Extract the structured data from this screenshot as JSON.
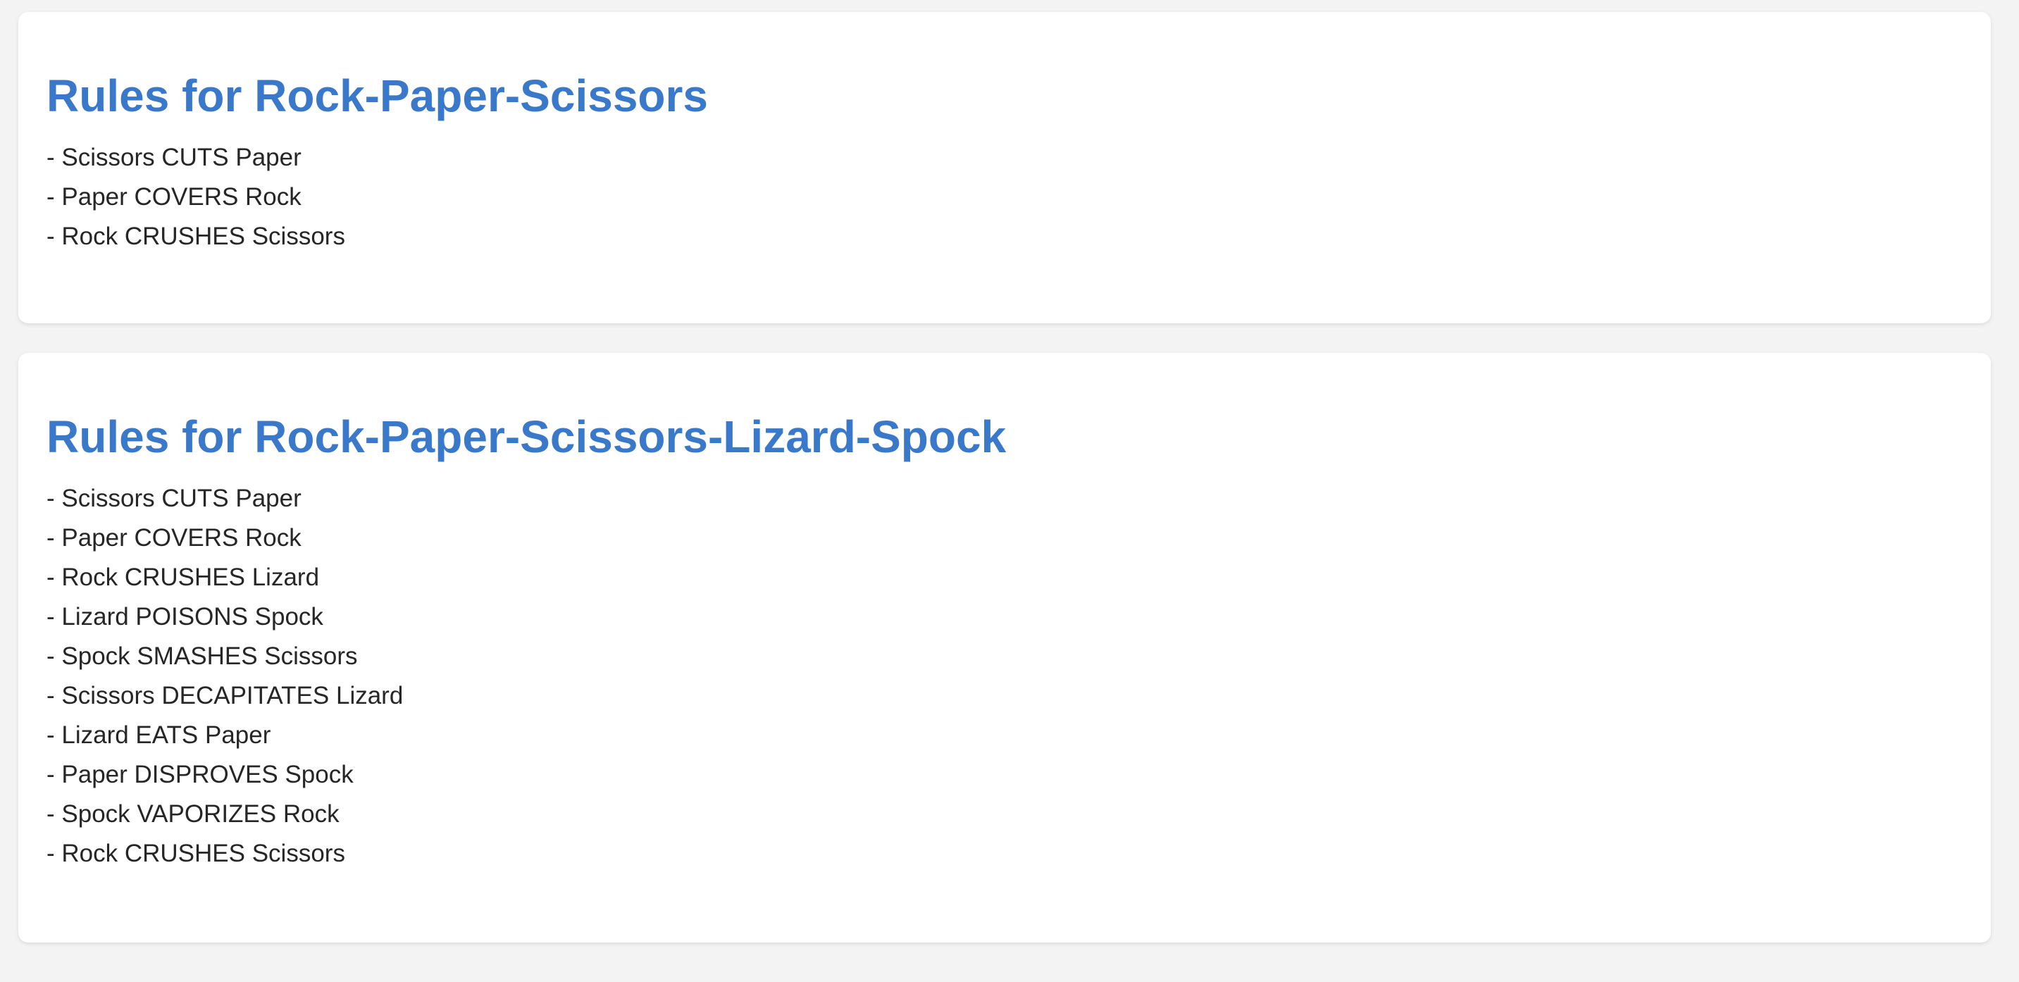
{
  "sections": [
    {
      "title": "Rules for Rock-Paper-Scissors",
      "rules": [
        "- Scissors CUTS Paper",
        "- Paper COVERS Rock",
        "- Rock CRUSHES Scissors"
      ]
    },
    {
      "title": "Rules for Rock-Paper-Scissors-Lizard-Spock",
      "rules": [
        "- Scissors CUTS Paper",
        "- Paper COVERS Rock",
        "- Rock CRUSHES Lizard",
        "- Lizard POISONS Spock",
        "- Spock SMASHES Scissors",
        "- Scissors DECAPITATES Lizard",
        "- Lizard EATS Paper",
        "- Paper DISPROVES Spock",
        "- Spock VAPORIZES Rock",
        "- Rock CRUSHES Scissors"
      ]
    }
  ],
  "colors": {
    "page_background": "#f3f3f3",
    "card_background": "#ffffff",
    "title": "#3a78c9",
    "text": "#262626"
  }
}
